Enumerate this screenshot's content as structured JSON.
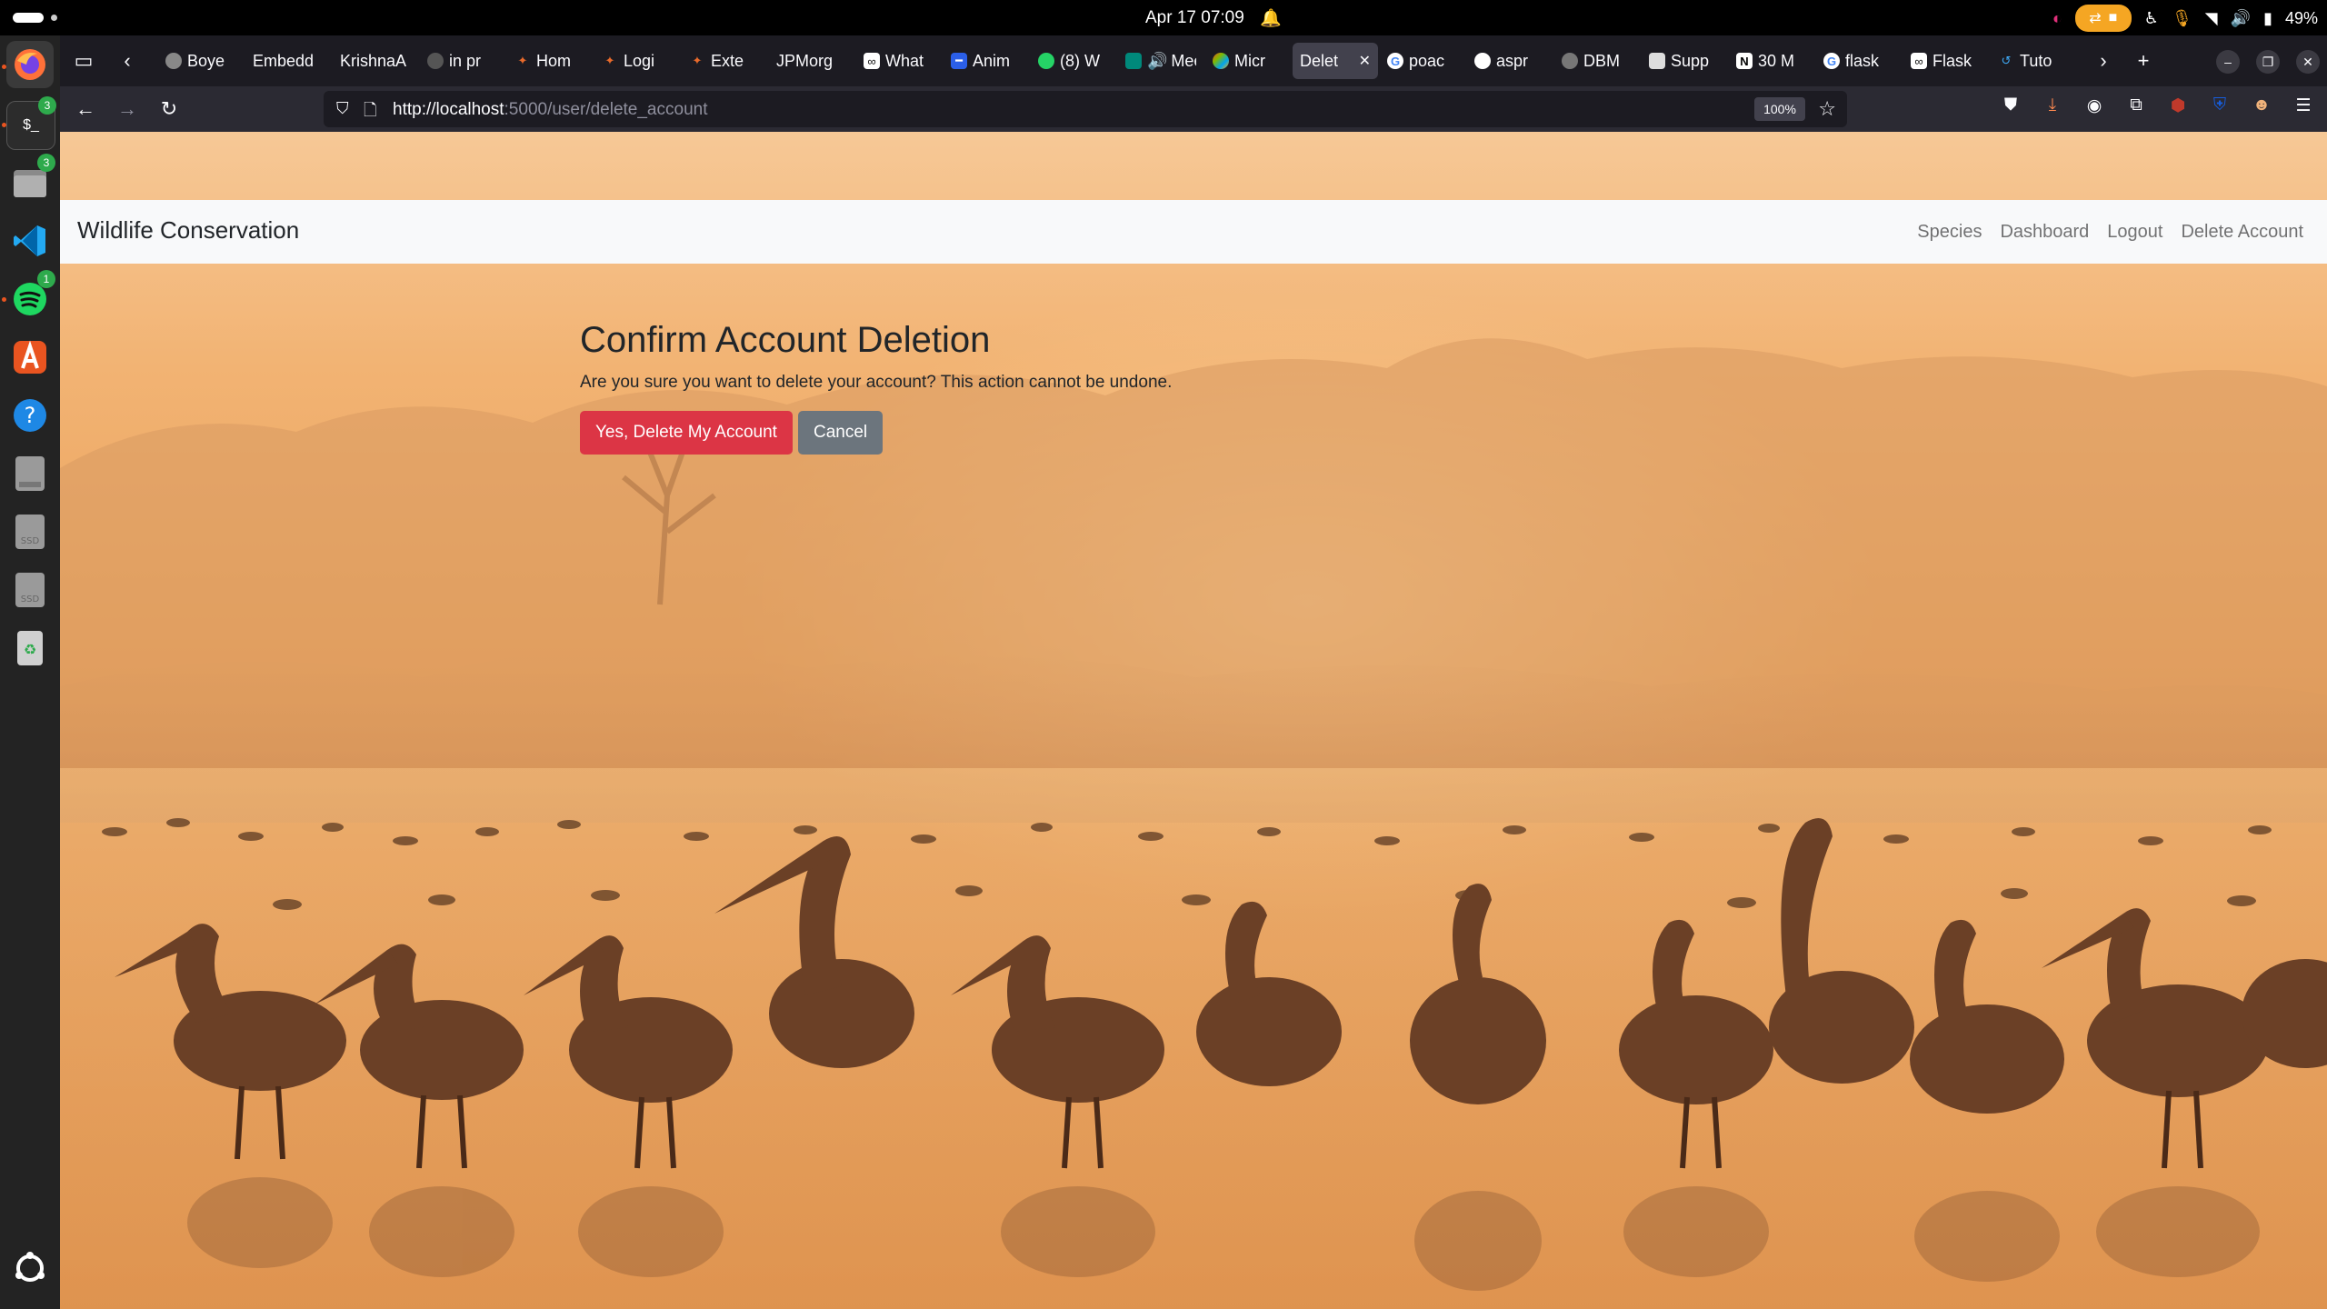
{
  "system": {
    "clock": "Apr 17  07:09",
    "battery": "49%",
    "bell_icon": "bell-icon"
  },
  "dock": {
    "items": [
      {
        "name": "firefox",
        "icon": "firefox-icon",
        "badge": ""
      },
      {
        "name": "terminal",
        "icon": "terminal-icon",
        "badge": "3"
      },
      {
        "name": "files",
        "icon": "folder-icon",
        "badge": "3"
      },
      {
        "name": "vscode",
        "icon": "vscode-icon",
        "badge": ""
      },
      {
        "name": "spotify",
        "icon": "spotify-icon",
        "badge": "1"
      },
      {
        "name": "app-center",
        "icon": "appstore-icon",
        "badge": ""
      },
      {
        "name": "help",
        "icon": "help-icon",
        "badge": ""
      },
      {
        "name": "disk-1",
        "icon": "disk-icon",
        "badge": ""
      },
      {
        "name": "disk-2",
        "icon": "disk-icon",
        "badge": ""
      },
      {
        "name": "disk-3",
        "icon": "disk-icon",
        "badge": ""
      },
      {
        "name": "trash",
        "icon": "trash-icon",
        "badge": ""
      }
    ]
  },
  "browser": {
    "tabs": [
      {
        "title": "Boye",
        "active": false
      },
      {
        "title": "Embedd",
        "active": false
      },
      {
        "title": "KrishnaA",
        "active": false
      },
      {
        "title": "in pr",
        "active": false
      },
      {
        "title": "Hom",
        "active": false
      },
      {
        "title": "Logi",
        "active": false
      },
      {
        "title": "Exte",
        "active": false
      },
      {
        "title": "JPMorg",
        "active": false
      },
      {
        "title": "What",
        "active": false
      },
      {
        "title": "Anim",
        "active": false
      },
      {
        "title": "(8) W",
        "active": false
      },
      {
        "title": "Meet",
        "active": false
      },
      {
        "title": "Micr",
        "active": false
      },
      {
        "title": "Delet",
        "active": true
      },
      {
        "title": "poac",
        "active": false
      },
      {
        "title": "aspr",
        "active": false
      },
      {
        "title": "DBM",
        "active": false
      },
      {
        "title": "Supp",
        "active": false
      },
      {
        "title": "30 M",
        "active": false
      },
      {
        "title": "flask",
        "active": false
      },
      {
        "title": "Flask",
        "active": false
      },
      {
        "title": "Tuto",
        "active": false
      }
    ],
    "url_host": "http://localhost",
    "url_path": ":5000/user/delete_account",
    "zoom": "100%"
  },
  "site": {
    "brand": "Wildlife Conservation",
    "nav": [
      "Species",
      "Dashboard",
      "Logout",
      "Delete Account"
    ],
    "title": "Confirm Account Deletion",
    "message": "Are you sure you want to delete your account? This action cannot be undone.",
    "confirm_label": "Yes, Delete My Account",
    "cancel_label": "Cancel",
    "colors": {
      "danger": "#dc3545",
      "secondary": "#6c757d",
      "navbar": "#f8f9fa"
    }
  }
}
